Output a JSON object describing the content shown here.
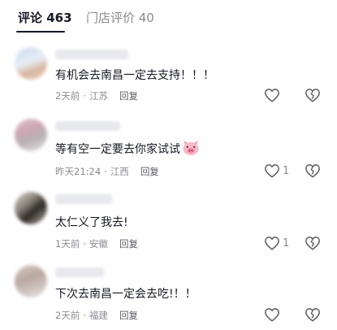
{
  "tabs": [
    {
      "label": "评论 463",
      "active": true
    },
    {
      "label": "门店评价 40",
      "active": false
    }
  ],
  "comments": [
    {
      "text": "有机会去南昌一定去支持！！！",
      "time": "2天前",
      "location": "江苏",
      "reply": "回复",
      "like_count": "",
      "emoji": ""
    },
    {
      "text": "等有空一定要去你家试试",
      "time": "昨天21:24",
      "location": "江西",
      "reply": "回复",
      "like_count": "1",
      "emoji": "pig-face-emoji"
    },
    {
      "text": "太仁义了我去!",
      "time": "1天前",
      "location": "安徽",
      "reply": "回复",
      "like_count": "1",
      "emoji": ""
    },
    {
      "text": "下次去南昌一定会去吃!！！",
      "time": "2天前",
      "location": "福建",
      "reply": "回复",
      "like_count": "",
      "emoji": ""
    }
  ],
  "icons": {
    "like": "heart-icon",
    "dislike": "broken-heart-icon"
  },
  "colors": {
    "text": "#161823",
    "secondary": "#8a8b91"
  }
}
